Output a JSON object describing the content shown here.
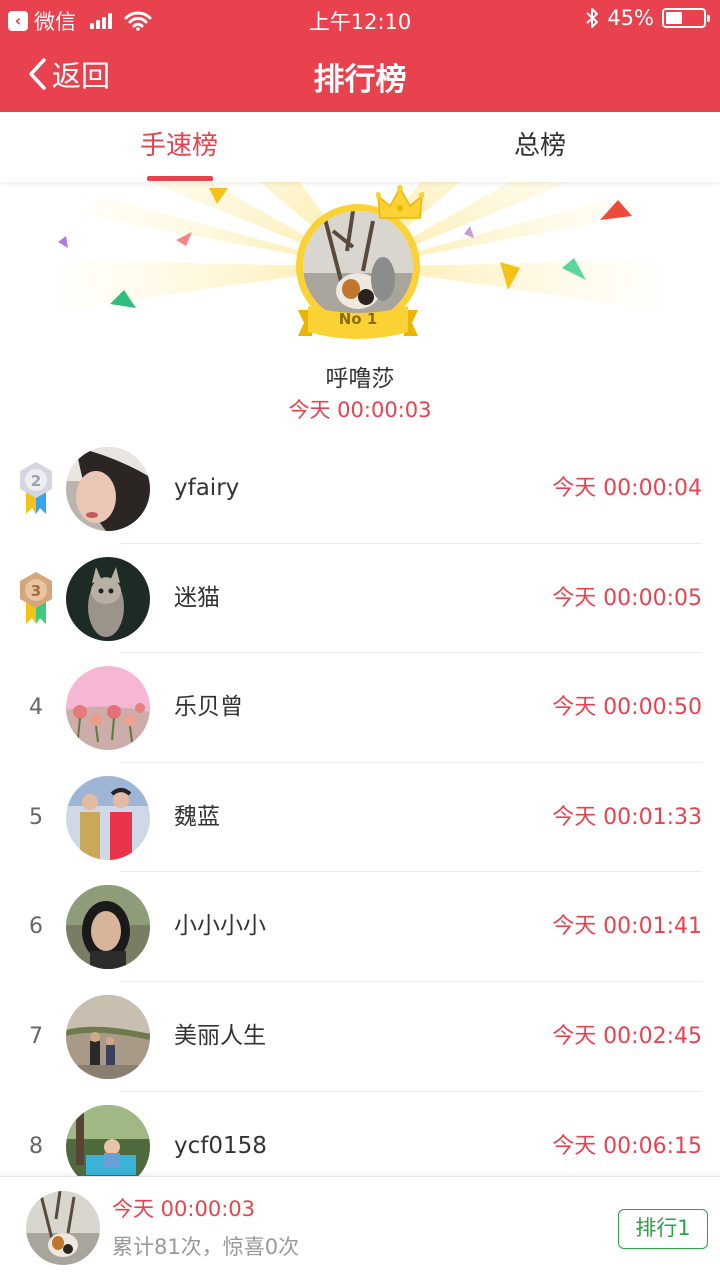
{
  "status_bar": {
    "carrier": "微信",
    "time": "上午12:10",
    "battery": "45%",
    "battery_level": 0.45
  },
  "nav": {
    "back_label": "返回",
    "title": "排行榜"
  },
  "tabs": [
    {
      "label": "手速榜",
      "active": true
    },
    {
      "label": "总榜",
      "active": false
    }
  ],
  "champion": {
    "badge": "No 1",
    "name": "呼噜莎",
    "time": "今天 00:00:03"
  },
  "ranking": [
    {
      "rank": "2",
      "name": "yfairy",
      "time": "今天 00:00:04",
      "medal": "silver-medal-icon"
    },
    {
      "rank": "3",
      "name": "迷猫",
      "time": "今天 00:00:05",
      "medal": "bronze-medal-icon"
    },
    {
      "rank": "4",
      "name": "乐贝曾",
      "time": "今天 00:00:50"
    },
    {
      "rank": "5",
      "name": "魏蓝",
      "time": "今天 00:01:33"
    },
    {
      "rank": "6",
      "name": "小小小小",
      "time": "今天 00:01:41"
    },
    {
      "rank": "7",
      "name": "美丽人生",
      "time": "今天 00:02:45"
    },
    {
      "rank": "8",
      "name": "ycf0158",
      "time": "今天 00:06:15"
    }
  ],
  "my_record": {
    "time": "今天 00:00:03",
    "stats": "累计81次，惊喜0次",
    "rank_button": "排行1"
  },
  "colors": {
    "accent": "#e9424f",
    "gold": "#fbd234",
    "rank_button": "#2ba245"
  }
}
